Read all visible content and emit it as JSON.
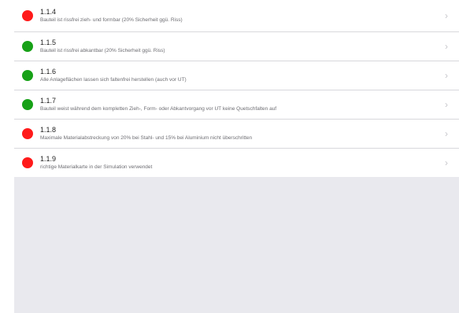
{
  "colors": {
    "red": "#ff1a1a",
    "green": "#17a117"
  },
  "items": [
    {
      "id": "1.1.4",
      "text": "Bauteil ist rissfrei zieh- und formbar (20% Sicherheit ggü. Riss)",
      "status": "red"
    },
    {
      "id": "1.1.5",
      "text": "Bauteil ist rissfrei abkantbar (20% Sicherheit ggü. Riss)",
      "status": "green"
    },
    {
      "id": "1.1.6",
      "text": "Alle Anlageflächen lassen sich faltenfrei herstellen (auch vor UT)",
      "status": "green"
    },
    {
      "id": "1.1.7",
      "text": "Bauteil weist während dem kompletten Zieh-, Form- oder Abkantvorgang vor UT keine Quetschfalten auf",
      "status": "green"
    },
    {
      "id": "1.1.8",
      "text": "Maximale Materialabstreckung von 20% bei Stahl- und 15% bei Aluminium nicht überschritten",
      "status": "red"
    },
    {
      "id": "1.1.9",
      "text": "richtige Materialkarte in der Simulation verwendet",
      "status": "red"
    }
  ],
  "chevron": "›"
}
